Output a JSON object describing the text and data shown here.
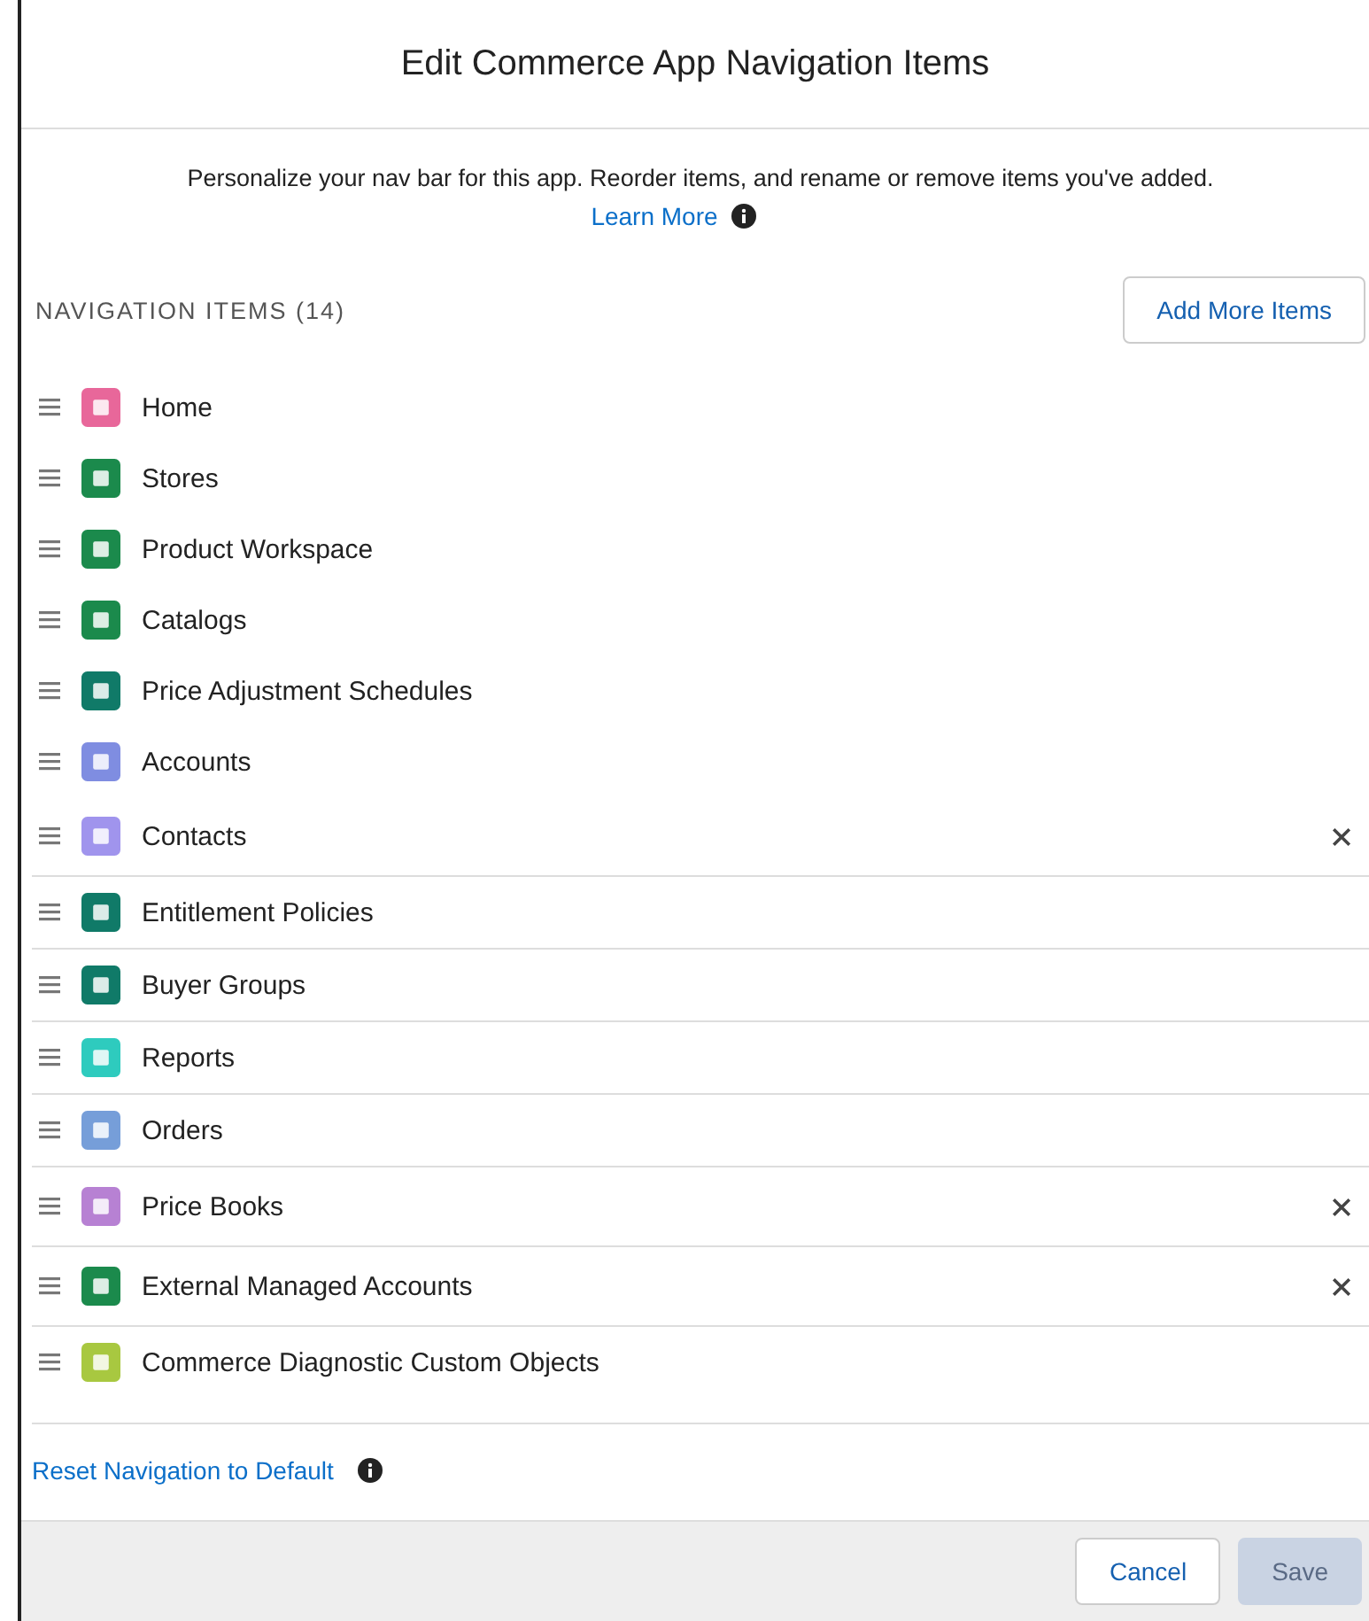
{
  "modal": {
    "title": "Edit Commerce App Navigation Items"
  },
  "description": "Personalize your nav bar for this app. Reorder items, and rename or remove items you've added.",
  "learn_more": "Learn More",
  "section_title": "NAVIGATION ITEMS (14)",
  "add_button": "Add More Items",
  "items": [
    {
      "label": "Home",
      "color": "#e8679a",
      "removable": false,
      "separated": false
    },
    {
      "label": "Stores",
      "color": "#1b8a4c",
      "removable": false,
      "separated": false
    },
    {
      "label": "Product Workspace",
      "color": "#1b8a4c",
      "removable": false,
      "separated": false
    },
    {
      "label": "Catalogs",
      "color": "#1b8a4c",
      "removable": false,
      "separated": false
    },
    {
      "label": "Price Adjustment Schedules",
      "color": "#107a68",
      "removable": false,
      "separated": false
    },
    {
      "label": "Accounts",
      "color": "#7f8de1",
      "removable": false,
      "separated": false
    },
    {
      "label": "Contacts",
      "color": "#a094ed",
      "removable": true,
      "separated": false
    },
    {
      "label": "Entitlement Policies",
      "color": "#107a68",
      "removable": false,
      "separated": true
    },
    {
      "label": "Buyer Groups",
      "color": "#107a68",
      "removable": false,
      "separated": true
    },
    {
      "label": "Reports",
      "color": "#2ecbbe",
      "removable": false,
      "separated": true
    },
    {
      "label": "Orders",
      "color": "#769ed9",
      "removable": false,
      "separated": true
    },
    {
      "label": "Price Books",
      "color": "#b781d3",
      "removable": true,
      "separated": true
    },
    {
      "label": "External Managed Accounts",
      "color": "#1b8a4c",
      "removable": true,
      "separated": true
    },
    {
      "label": "Commerce Diagnostic Custom Objects",
      "color": "#a8c840",
      "removable": false,
      "separated": true
    }
  ],
  "reset_link": "Reset Navigation to Default",
  "buttons": [
    {
      "label": "Cancel",
      "kind": "neutral",
      "disabled": false
    },
    {
      "label": "Save",
      "kind": "brand",
      "disabled": true
    }
  ]
}
